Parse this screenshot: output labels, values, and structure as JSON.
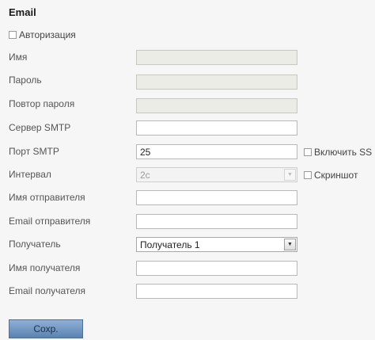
{
  "section_title": "Email",
  "auth": {
    "label": "Авторизация",
    "checked": false
  },
  "fields": {
    "name": {
      "label": "Имя",
      "value": ""
    },
    "password": {
      "label": "Пароль",
      "value": ""
    },
    "confirm": {
      "label": "Повтор пароля",
      "value": ""
    },
    "smtp_server": {
      "label": "Сервер SMTP",
      "value": ""
    },
    "smtp_port": {
      "label": "Порт SMTP",
      "value": "25"
    },
    "interval": {
      "label": "Интервал",
      "value": "2с"
    },
    "sender_name": {
      "label": "Имя отправителя",
      "value": ""
    },
    "sender_email": {
      "label": "Email отправителя",
      "value": ""
    },
    "recipient": {
      "label": "Получатель",
      "value": "Получатель 1"
    },
    "recipient_name": {
      "label": "Имя получателя",
      "value": ""
    },
    "recipient_email": {
      "label": "Email получателя",
      "value": ""
    }
  },
  "enable_ssl": {
    "label": "Включить SS",
    "checked": false
  },
  "screenshot": {
    "label": "Скриншот",
    "checked": false
  },
  "save_label": "Сохр."
}
